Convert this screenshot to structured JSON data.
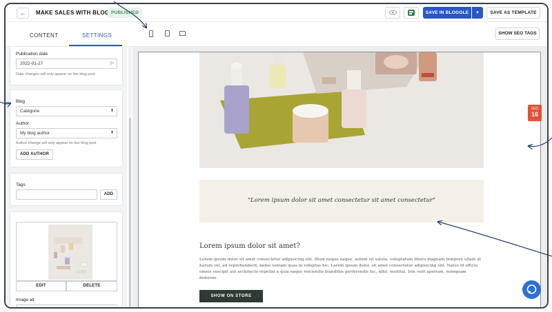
{
  "topbar": {
    "back_icon": "←",
    "title": "MAKE SALES WITH BLOG",
    "status_badge": "PUBLISHED",
    "save_in_bloggle": "SAVE IN BLOGGLE",
    "save_dropdown_icon": "▾",
    "save_as_template": "SAVE AS TEMPLATE"
  },
  "tabs": {
    "content": "CONTENT",
    "settings": "SETTINGS",
    "active": "settings"
  },
  "toolbar": {
    "show_seo_tags": "SHOW SEO TAGS",
    "devices": [
      "mobile-icon",
      "tablet-icon",
      "desktop-icon"
    ]
  },
  "sidebar": {
    "publication": {
      "label": "Publication date",
      "value": "2022-01-27",
      "hint": "Date changes will only appear on live blog post"
    },
    "blog": {
      "label": "Blog",
      "value": "Catégorie",
      "author_label": "Author",
      "author_value": "My blog author",
      "author_hint": "Author change will only appear on live blog post",
      "add_author": "ADD AUTHOR"
    },
    "tags": {
      "label": "Tags",
      "input_value": "",
      "add": "ADD"
    },
    "image": {
      "edit": "EDIT",
      "delete": "DELETE",
      "alt_label": "Image alt"
    }
  },
  "preview": {
    "quote": "\"Lorem ipsum dolor sit amet consectetur sit amet consectetur\"",
    "article_title": "Lorem ipsum dolor sit amet?",
    "article_body": "Lorem ipsum dolor sit amet consectetur adipisicing elit. Illum neque eaque, autem sit soluta, voluptatum libero magnam tempore ullam at harum vel, ad reprehenderit, nemo veniam quas in voluptas hic. Lorem ipsum dolor, sit amet consectetur adipisicing elit. Natus id officia omnis suscipit aut architecto repellat a quia eaque reiciendis blanditiis perferendis hic, nihil, mollitia. Iste velit aperiam, numquam dolorem.",
    "cta": "SHOW ON STORE"
  },
  "seo_badge": {
    "label": "SEO",
    "score": "16"
  },
  "colors": {
    "primary": "#2a57c7",
    "published_bg": "#e6f4ea",
    "cta_bg": "#2f3a34",
    "seo_badge": "#e0533a",
    "chat": "#2f6fd6"
  }
}
